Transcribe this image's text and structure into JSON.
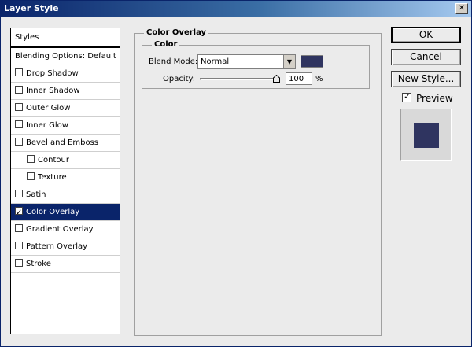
{
  "window": {
    "title": "Layer Style",
    "close_glyph": "✕"
  },
  "left_panel": {
    "header": "Styles",
    "items": [
      {
        "label": "Blending Options: Default",
        "checkbox": false,
        "checked": false,
        "indent": false,
        "selected": false
      },
      {
        "label": "Drop Shadow",
        "checkbox": true,
        "checked": false,
        "indent": false,
        "selected": false
      },
      {
        "label": "Inner Shadow",
        "checkbox": true,
        "checked": false,
        "indent": false,
        "selected": false
      },
      {
        "label": "Outer Glow",
        "checkbox": true,
        "checked": false,
        "indent": false,
        "selected": false
      },
      {
        "label": "Inner Glow",
        "checkbox": true,
        "checked": false,
        "indent": false,
        "selected": false
      },
      {
        "label": "Bevel and Emboss",
        "checkbox": true,
        "checked": false,
        "indent": false,
        "selected": false
      },
      {
        "label": "Contour",
        "checkbox": true,
        "checked": false,
        "indent": true,
        "selected": false
      },
      {
        "label": "Texture",
        "checkbox": true,
        "checked": false,
        "indent": true,
        "selected": false
      },
      {
        "label": "Satin",
        "checkbox": true,
        "checked": false,
        "indent": false,
        "selected": false
      },
      {
        "label": "Color Overlay",
        "checkbox": true,
        "checked": true,
        "indent": false,
        "selected": true
      },
      {
        "label": "Gradient Overlay",
        "checkbox": true,
        "checked": false,
        "indent": false,
        "selected": false
      },
      {
        "label": "Pattern Overlay",
        "checkbox": true,
        "checked": false,
        "indent": false,
        "selected": false
      },
      {
        "label": "Stroke",
        "checkbox": true,
        "checked": false,
        "indent": false,
        "selected": false
      }
    ]
  },
  "color_overlay": {
    "group_title": "Color Overlay",
    "subgroup_title": "Color",
    "blend_mode_label": "Blend Mode:",
    "blend_mode_value": "Normal",
    "dropdown_glyph": "▼",
    "overlay_color": "#2f3460",
    "opacity_label": "Opacity:",
    "opacity_value": "100",
    "opacity_unit": "%",
    "opacity_fraction": 1.0
  },
  "buttons": {
    "ok": "OK",
    "cancel": "Cancel",
    "new_style": "New Style..."
  },
  "preview": {
    "label": "Preview",
    "checked": true
  },
  "colors": {
    "selection": "#0a246a",
    "title_bar": "#0a246a"
  }
}
